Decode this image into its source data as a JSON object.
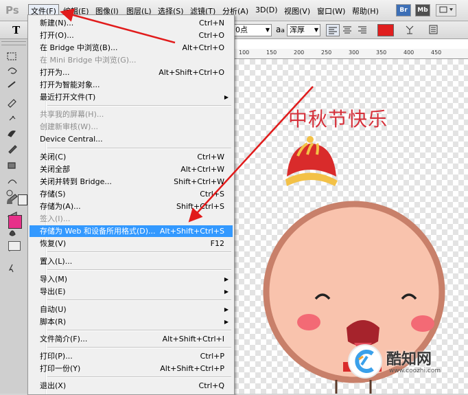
{
  "app": {
    "logo": "Ps"
  },
  "menubar": {
    "items": [
      "文件(F)",
      "编辑(E)",
      "图像(I)",
      "图层(L)",
      "选择(S)",
      "滤镜(T)",
      "分析(A)",
      "3D(D)",
      "视图(V)",
      "窗口(W)",
      "帮助(H)"
    ],
    "bridge_label": "Br",
    "minibridge_label": "Mb"
  },
  "options": {
    "font_size": "0点",
    "aa_label": "a",
    "aa_value": "浑厚",
    "text_color": "#e01f1f"
  },
  "colors": {
    "foreground": "#e7318a",
    "background": "#ffffff",
    "title": "#d6303a",
    "highlight": "#3399ff"
  },
  "canvas": {
    "title": "中秋节快乐",
    "ruler_ticks": [
      "100",
      "150",
      "200",
      "250",
      "300",
      "350",
      "400",
      "450"
    ]
  },
  "file_menu": {
    "items": [
      {
        "label": "新建(N)...",
        "shortcut": "Ctrl+N"
      },
      {
        "label": "打开(O)...",
        "shortcut": "Ctrl+O"
      },
      {
        "label": "在 Bridge 中浏览(B)...",
        "shortcut": "Alt+Ctrl+O"
      },
      {
        "label": "在 Mini Bridge 中浏览(G)...",
        "shortcut": "",
        "disabled": true
      },
      {
        "label": "打开为...",
        "shortcut": "Alt+Shift+Ctrl+O"
      },
      {
        "label": "打开为智能对象...",
        "shortcut": ""
      },
      {
        "label": "最近打开文件(T)",
        "shortcut": "",
        "submenu": true
      },
      {
        "label": "共享我的屏幕(H)...",
        "shortcut": "",
        "disabled": true
      },
      {
        "label": "创建新审核(W)...",
        "shortcut": "",
        "disabled": true
      },
      {
        "label": "Device Central...",
        "shortcut": ""
      },
      {
        "label": "关闭(C)",
        "shortcut": "Ctrl+W"
      },
      {
        "label": "关闭全部",
        "shortcut": "Alt+Ctrl+W"
      },
      {
        "label": "关闭并转到 Bridge...",
        "shortcut": "Shift+Ctrl+W"
      },
      {
        "label": "存储(S)",
        "shortcut": "Ctrl+S"
      },
      {
        "label": "存储为(A)...",
        "shortcut": "Shift+Ctrl+S"
      },
      {
        "label": "签入(I)...",
        "shortcut": "",
        "disabled": true
      },
      {
        "label": "存储为 Web 和设备所用格式(D)...",
        "shortcut": "Alt+Shift+Ctrl+S",
        "highlighted": true
      },
      {
        "label": "恢复(V)",
        "shortcut": "F12"
      },
      {
        "label": "置入(L)...",
        "shortcut": ""
      },
      {
        "label": "导入(M)",
        "shortcut": "",
        "submenu": true
      },
      {
        "label": "导出(E)",
        "shortcut": "",
        "submenu": true
      },
      {
        "label": "自动(U)",
        "shortcut": "",
        "submenu": true
      },
      {
        "label": "脚本(R)",
        "shortcut": "",
        "submenu": true
      },
      {
        "label": "文件简介(F)...",
        "shortcut": "Alt+Shift+Ctrl+I"
      },
      {
        "label": "打印(P)...",
        "shortcut": "Ctrl+P"
      },
      {
        "label": "打印一份(Y)",
        "shortcut": "Alt+Shift+Ctrl+P"
      },
      {
        "label": "退出(X)",
        "shortcut": "Ctrl+Q"
      }
    ]
  },
  "watermark": {
    "brand": "酷知网",
    "url": "www.coozhi.com"
  }
}
